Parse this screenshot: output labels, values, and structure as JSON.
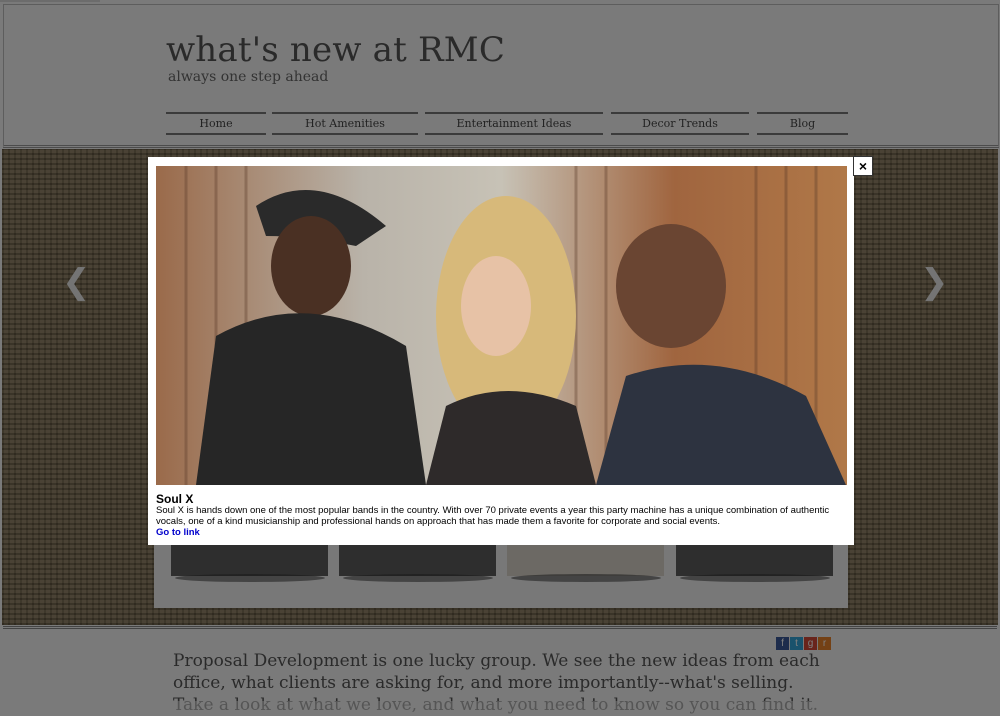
{
  "site": {
    "title": "what's new at RMC",
    "tagline": "always one step ahead"
  },
  "nav": {
    "items": [
      {
        "label": "Home"
      },
      {
        "label": "Hot Amenities"
      },
      {
        "label": "Entertainment Ideas"
      },
      {
        "label": "Decor Trends"
      },
      {
        "label": "Blog"
      }
    ]
  },
  "carousel": {
    "prev_icon": "chevron-left-icon",
    "next_icon": "chevron-right-icon"
  },
  "social": {
    "icons": [
      "facebook-icon",
      "twitter-icon",
      "google-plus-icon",
      "rss-icon"
    ],
    "glyphs": [
      "f",
      "t",
      "g",
      "r"
    ],
    "colors": [
      "#3b5998",
      "#33a5d8",
      "#d34836",
      "#e8822a"
    ]
  },
  "body": {
    "text": "Proposal Development is one lucky group. We see the new ideas from each office, what clients are asking for, and more importantly--what's selling. Take a look at what we love, and what you need to know so you can find it."
  },
  "lightbox": {
    "close_label": "×",
    "title": "Soul X",
    "description": "Soul X is hands down one of the most popular bands in the country. With over 70 private events a year this party machine has a unique combination of authentic vocals, one of a kind musicianship and professional hands on approach that has made them a favorite for corporate and social events.",
    "link_label": "Go to link"
  }
}
